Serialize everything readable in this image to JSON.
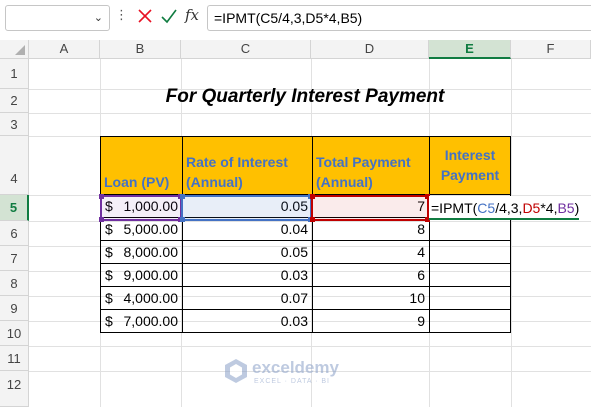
{
  "formula_bar": {
    "name_box": "",
    "formula": "=IPMT(C5/4,3,D5*4,B5)",
    "fx_label": "fx",
    "colors": {
      "cancel": "#e81123",
      "enter": "#107c41"
    }
  },
  "columns": [
    "A",
    "B",
    "C",
    "D",
    "E",
    "F"
  ],
  "rows": [
    "1",
    "2",
    "3",
    "4",
    "5",
    "6",
    "7",
    "8",
    "9",
    "10",
    "11",
    "12"
  ],
  "active": {
    "column": "E",
    "row": "5"
  },
  "sheet": {
    "title": "For Quarterly Interest Payment",
    "headers": {
      "loan": "Loan (PV)",
      "rate_1": "Rate of Interest",
      "rate_2": "(Annual)",
      "total_1": "Total Payment",
      "total_2": "(Annual)",
      "interest_1": "Interest",
      "interest_2": "Payment"
    },
    "header_fill": "#ffc000",
    "header_text": "#4472c4",
    "rows": [
      {
        "dollar": "$",
        "loan": "1,000.00",
        "rate": "0.05",
        "total": "7"
      },
      {
        "dollar": "$",
        "loan": "5,000.00",
        "rate": "0.04",
        "total": "8"
      },
      {
        "dollar": "$",
        "loan": "8,000.00",
        "rate": "0.05",
        "total": "4"
      },
      {
        "dollar": "$",
        "loan": "9,000.00",
        "rate": "0.03",
        "total": "6"
      },
      {
        "dollar": "$",
        "loan": "4,000.00",
        "rate": "0.07",
        "total": "10"
      },
      {
        "dollar": "$",
        "loan": "7,000.00",
        "rate": "0.03",
        "total": "9"
      }
    ],
    "edit": {
      "p1": "=IPMT(",
      "c5": "C5",
      "p2": "/4,3,",
      "d5": "D5",
      "p3": "*4,",
      "b5": "B5",
      "p4": ")"
    }
  },
  "watermark": {
    "name": "exceldemy",
    "tagline": "EXCEL · DATA · BI"
  }
}
